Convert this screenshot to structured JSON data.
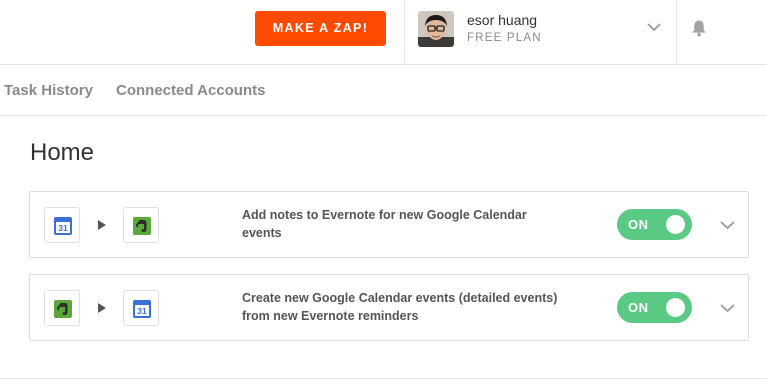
{
  "header": {
    "make_zap_label": "MAKE A ZAP!",
    "user_name": "esor huang",
    "user_plan": "FREE PLAN"
  },
  "nav": {
    "items": [
      {
        "label": "Task History"
      },
      {
        "label": "Connected Accounts"
      }
    ]
  },
  "main": {
    "title": "Home",
    "zaps": [
      {
        "trigger_icon": "google-calendar-icon",
        "action_icon": "evernote-icon",
        "description": "Add notes to Evernote for new Google Calendar events",
        "toggle_label": "ON",
        "enabled": true
      },
      {
        "trigger_icon": "evernote-icon",
        "action_icon": "google-calendar-icon",
        "description": "Create new Google Calendar events (detailed events) from new Evernote reminders",
        "toggle_label": "ON",
        "enabled": true
      }
    ],
    "calendar_icon_text": "31"
  },
  "colors": {
    "accent": "#ff4a00",
    "toggle_on": "#5ac984",
    "google_blue": "#3b6fd8",
    "evernote_green": "#5aa838"
  }
}
